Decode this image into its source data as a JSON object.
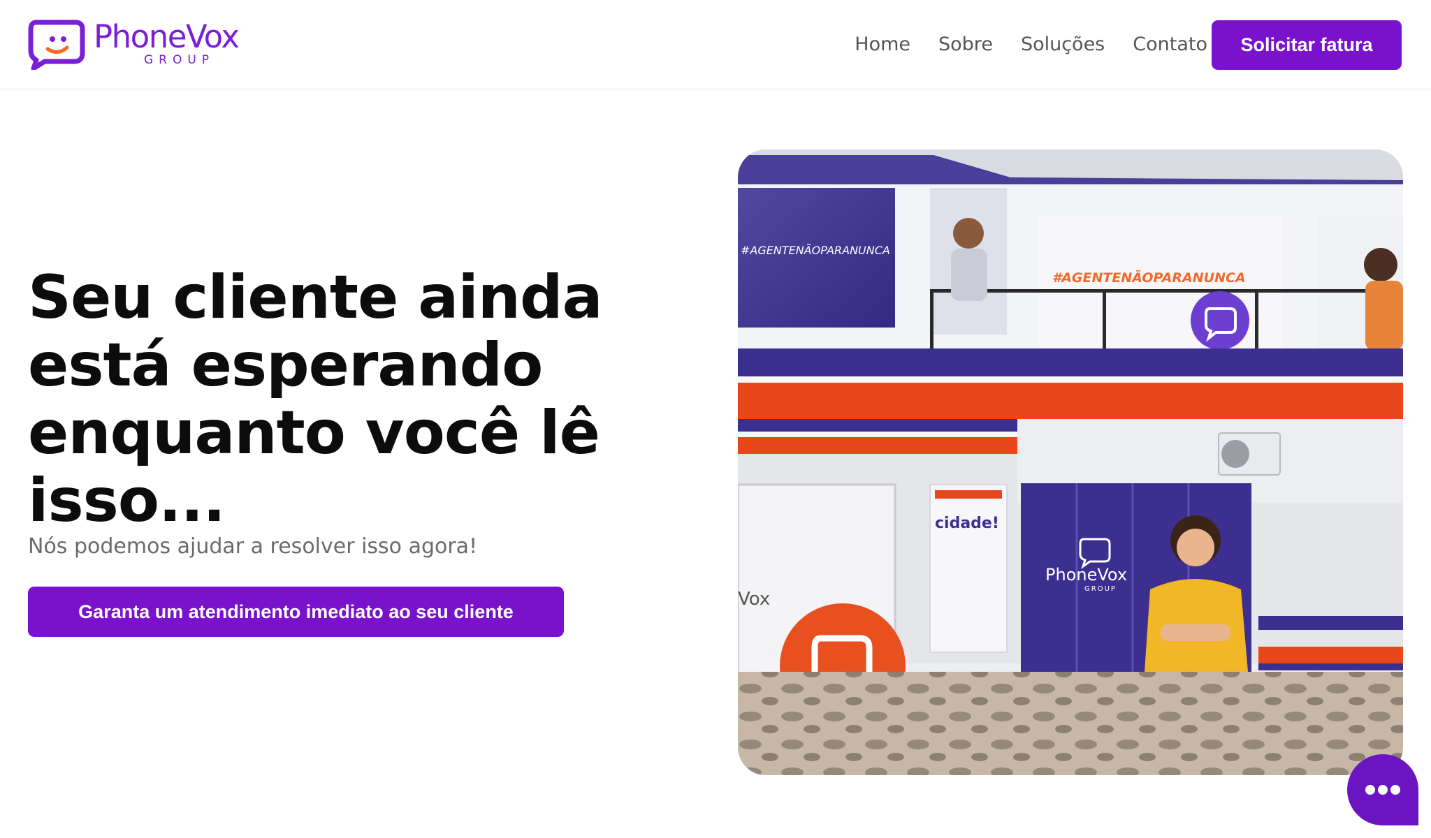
{
  "brand": {
    "name": "PhoneVox",
    "sub": "GROUP",
    "color": "#7a1fd6"
  },
  "nav": {
    "items": [
      {
        "label": "Home"
      },
      {
        "label": "Sobre"
      },
      {
        "label": "Soluções"
      },
      {
        "label": "Contato"
      }
    ],
    "cta_label": "Solicitar fatura"
  },
  "hero": {
    "title": "Seu cliente ainda está esperando enquanto você lê isso...",
    "subtitle": "Nós podemos ajudar a resolver isso agora!",
    "cta_label": "Garanta um atendimento imediato ao seu cliente"
  },
  "storefront": {
    "hashtag": "#AGENTENÃOPARANUNCA",
    "poster": "cidade!",
    "door_brand": "PhoneVox",
    "door_sub": "GROUP",
    "wall_text": "Vox"
  },
  "chat": {
    "icon": "chat-dots-icon"
  },
  "colors": {
    "accent": "#7a12cc",
    "facade_purple": "#3d2f8f",
    "facade_orange": "#e8471c"
  }
}
